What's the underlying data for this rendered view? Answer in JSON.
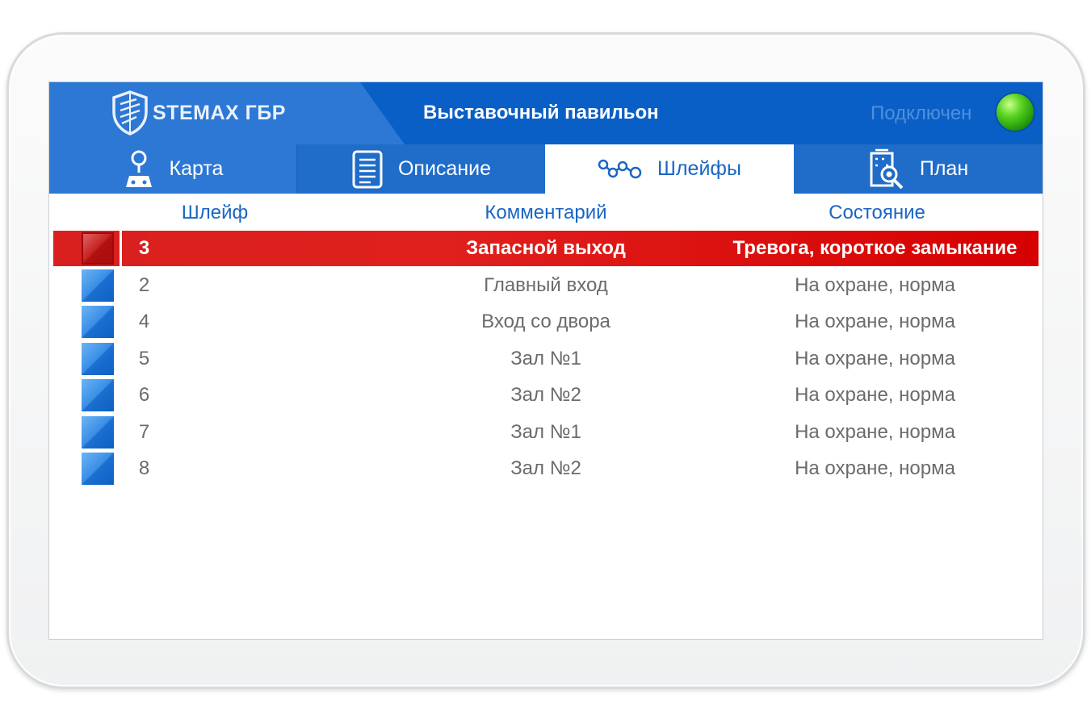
{
  "app": {
    "logo_text": "STEMAX ГБР",
    "object_title": "Выставочный павильон",
    "connection_status": "Подключен",
    "connection_color": "#3fbf18"
  },
  "tabs": [
    {
      "label": "Карта",
      "icon": "map-pin-icon"
    },
    {
      "label": "Описание",
      "icon": "document-icon"
    },
    {
      "label": "Шлейфы",
      "icon": "zones-chain-icon",
      "active": true
    },
    {
      "label": "План",
      "icon": "building-plan-icon"
    }
  ],
  "table": {
    "columns": [
      "Шлейф",
      "Комментарий",
      "Состояние"
    ],
    "rows": [
      {
        "zone": "3",
        "comment": "Запасной выход",
        "status": "Тревога, короткое замыкание",
        "alarm": true
      },
      {
        "zone": "2",
        "comment": "Главный вход",
        "status": "На охране, норма"
      },
      {
        "zone": "4",
        "comment": "Вход со двора",
        "status": "На охране, норма"
      },
      {
        "zone": "5",
        "comment": "Зал №1",
        "status": "На охране, норма"
      },
      {
        "zone": "6",
        "comment": "Зал №2",
        "status": "На охране, норма"
      },
      {
        "zone": "7",
        "comment": "Зал №1",
        "status": "На охране, норма"
      },
      {
        "zone": "8",
        "comment": "Зал №2",
        "status": "На охране, норма"
      }
    ]
  },
  "colors": {
    "header_blue": "#0a5fc6",
    "tab_blue": "#2c78d4",
    "alarm_red": "#d9201e",
    "ok_blue": "#2f86e0"
  }
}
